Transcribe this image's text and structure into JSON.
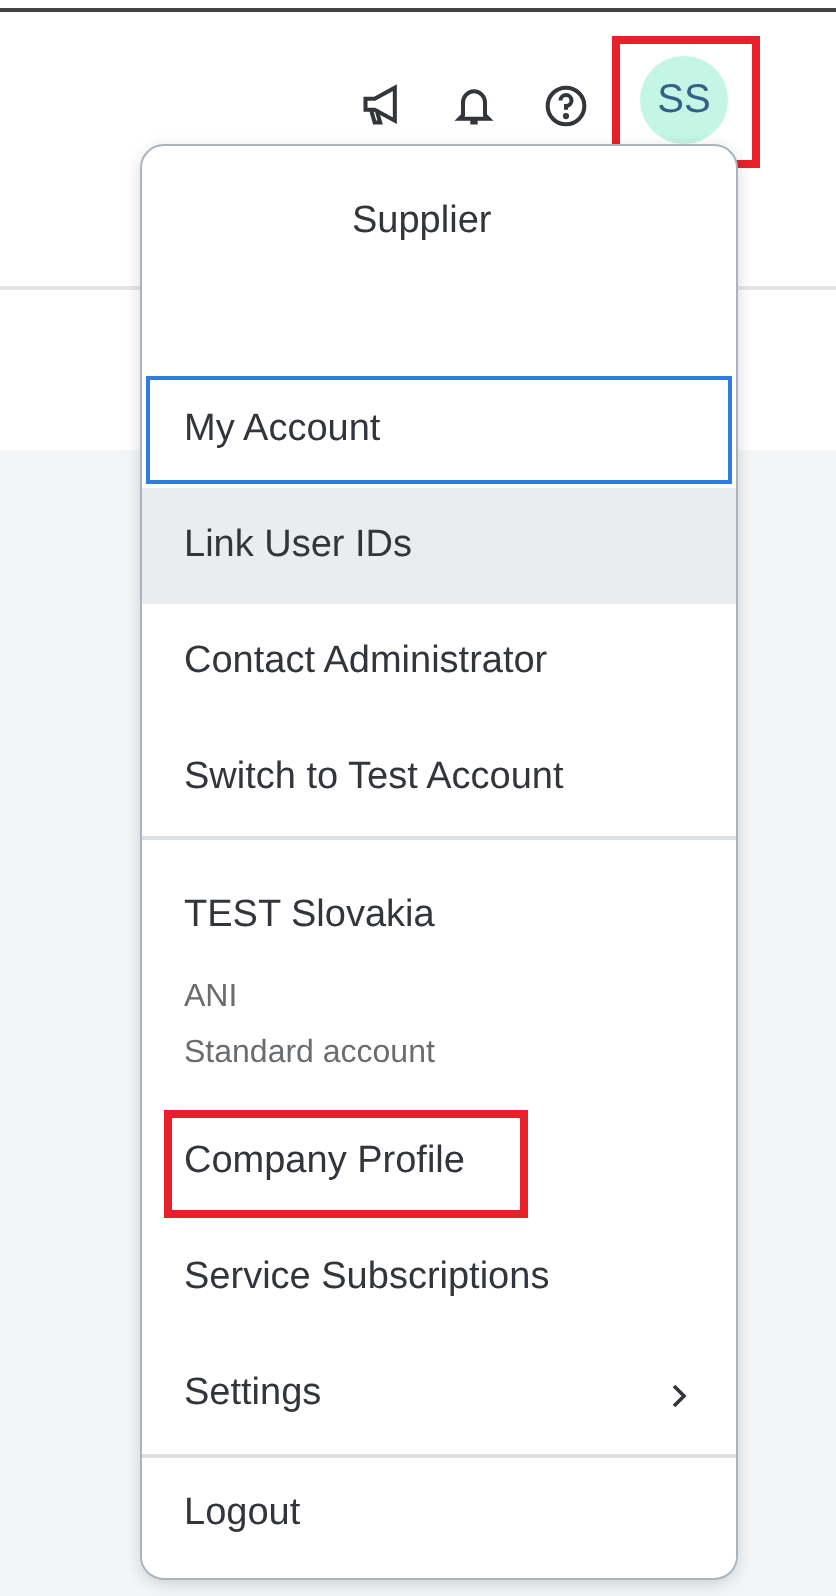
{
  "toolbar": {
    "avatar": {
      "initials": "SS",
      "highlighted": true
    }
  },
  "menu": {
    "header": {
      "name": "Supplier"
    },
    "items": [
      {
        "label": "My Account",
        "focused": true,
        "hovered": false,
        "highlighted": false,
        "submenu": false
      },
      {
        "label": "Link User IDs",
        "focused": false,
        "hovered": true,
        "highlighted": false,
        "submenu": false
      },
      {
        "label": "Contact Administrator",
        "focused": false,
        "hovered": false,
        "highlighted": false,
        "submenu": false
      },
      {
        "label": "Switch to Test Account",
        "focused": false,
        "hovered": false,
        "highlighted": false,
        "submenu": false
      }
    ],
    "account": {
      "name": "TEST Slovakia",
      "anid": "ANI",
      "type": "Standard account"
    },
    "account_items": [
      {
        "label": "Company Profile",
        "focused": false,
        "hovered": false,
        "highlighted": true,
        "submenu": false
      },
      {
        "label": "Service Subscriptions",
        "focused": false,
        "hovered": false,
        "highlighted": false,
        "submenu": false
      },
      {
        "label": "Settings",
        "focused": false,
        "hovered": false,
        "highlighted": false,
        "submenu": true
      }
    ],
    "footer_items": [
      {
        "label": "Logout",
        "focused": false,
        "hovered": false,
        "highlighted": false,
        "submenu": false
      }
    ]
  }
}
